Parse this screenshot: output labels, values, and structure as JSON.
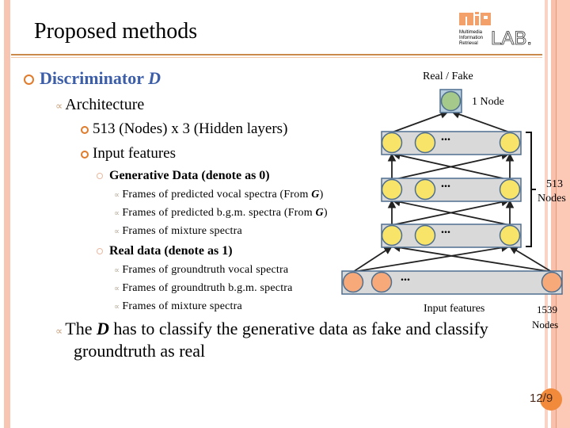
{
  "slide": {
    "title": "Proposed methods",
    "page_number": "12/9",
    "colors": {
      "accent_blue": "#3c5ea8",
      "accent_orange": "#e07b2b",
      "page_badge": "#f28a3c"
    }
  },
  "logo": {
    "main": "MIR",
    "lab": "LAB.",
    "lines": [
      "Multimedia",
      "Information",
      "Retrieval"
    ]
  },
  "content": {
    "heading": {
      "text": "Discriminator ",
      "italic": "D"
    },
    "architecture": "Architecture",
    "hidden_layers": "513 (Nodes) x 3 (Hidden layers)",
    "input_features": "Input features",
    "generative": {
      "label": "Generative Data (denote as 0)",
      "items": [
        {
          "text": "Frames of  predicted vocal spectra (From ",
          "bold": "G",
          "end": ")"
        },
        {
          "text": "Frames of  predicted b.g.m. spectra (From ",
          "bold": "G",
          "end": ")"
        },
        {
          "text": "Frames of  mixture spectra",
          "bold": "",
          "end": ""
        }
      ]
    },
    "real": {
      "label": "Real data (denote as 1)",
      "items": [
        "Frames of groundtruth vocal spectra",
        "Frames of groundtruth b.g.m. spectra",
        "Frames of  mixture spectra"
      ]
    },
    "conclusion": {
      "pre": "The ",
      "bold": "D",
      "post": " has to classify the generative data as fake and classify",
      "line2": "groundtruth as real"
    }
  },
  "diagram": {
    "output_label": "Real / Fake",
    "output_nodes": "1 Node",
    "hidden_nodes_count": "513",
    "hidden_nodes_word": "Nodes",
    "input_label": "Input features",
    "input_nodes_count": "1539",
    "input_nodes_word": "Nodes",
    "ellipsis": "...",
    "colors": {
      "output_node": "#a4c98a",
      "hidden_node": "#f9e46a",
      "input_node": "#f8a97a",
      "layer_box": "#d9d9d9",
      "layer_border": "#4f6f8f"
    }
  }
}
